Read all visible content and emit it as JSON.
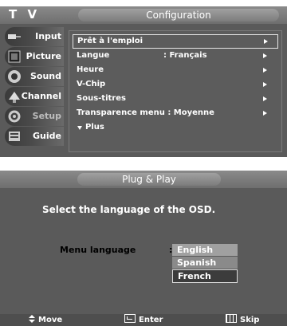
{
  "tv_screen": {
    "title": "T V",
    "header": "Configuration",
    "sidebar": [
      {
        "label": "Input",
        "icon": "input-icon"
      },
      {
        "label": "Picture",
        "icon": "picture-icon"
      },
      {
        "label": "Sound",
        "icon": "sound-icon"
      },
      {
        "label": "Channel",
        "icon": "channel-icon"
      },
      {
        "label": "Setup",
        "icon": "setup-icon"
      },
      {
        "label": "Guide",
        "icon": "guide-icon"
      }
    ],
    "menu": [
      {
        "label": "Prêt à l'emploi",
        "value": ""
      },
      {
        "label": "Langue",
        "value": ": Français"
      },
      {
        "label": "Heure",
        "value": ""
      },
      {
        "label": "V-Chip",
        "value": ""
      },
      {
        "label": "Sous-titres",
        "value": ""
      },
      {
        "label": "Transparence menu : Moyenne",
        "value": ""
      },
      {
        "label": "Plus",
        "value": ""
      }
    ]
  },
  "plug_and_play": {
    "header": "Plug & Play",
    "prompt": "Select the language of the OSD.",
    "menu_language_label": "Menu language",
    "colon": ":",
    "options": [
      "English",
      "Spanish",
      "French"
    ],
    "current_option": "English",
    "focused_option": "French"
  },
  "footer": {
    "move": "Move",
    "enter": "Enter",
    "skip": "Skip"
  },
  "colors": {
    "panel_bg": "#5a5a5a",
    "header_bar": "#7c7c7c",
    "focus_border": "#e6e6e6"
  }
}
